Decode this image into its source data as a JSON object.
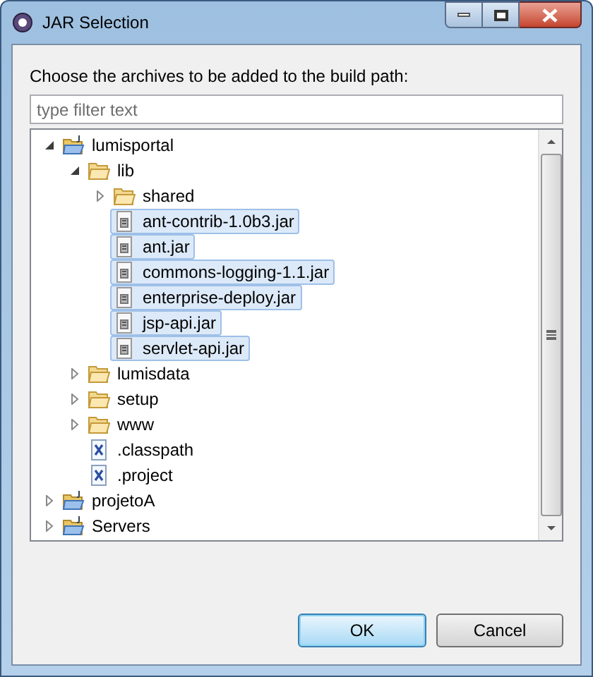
{
  "window": {
    "title": "JAR Selection"
  },
  "prompt": "Choose the archives to be added to the build path:",
  "filter": {
    "placeholder": "type filter text"
  },
  "tree": [
    {
      "label": "lumisportal",
      "kind": "project",
      "expanded": true,
      "selected": false,
      "children": [
        {
          "label": "lib",
          "kind": "folder",
          "expanded": true,
          "selected": false,
          "children": [
            {
              "label": "shared",
              "kind": "folder",
              "expanded": false,
              "selected": false
            },
            {
              "label": "ant-contrib-1.0b3.jar",
              "kind": "jar",
              "selected": true
            },
            {
              "label": "ant.jar",
              "kind": "jar",
              "selected": true
            },
            {
              "label": "commons-logging-1.1.jar",
              "kind": "jar",
              "selected": true
            },
            {
              "label": "enterprise-deploy.jar",
              "kind": "jar",
              "selected": true
            },
            {
              "label": "jsp-api.jar",
              "kind": "jar",
              "selected": true
            },
            {
              "label": "servlet-api.jar",
              "kind": "jar",
              "selected": true
            }
          ]
        },
        {
          "label": "lumisdata",
          "kind": "folder",
          "expanded": false,
          "selected": false
        },
        {
          "label": "setup",
          "kind": "folder",
          "expanded": false,
          "selected": false
        },
        {
          "label": "www",
          "kind": "folder",
          "expanded": false,
          "selected": false
        },
        {
          "label": ".classpath",
          "kind": "xml",
          "selected": false
        },
        {
          "label": ".project",
          "kind": "xml",
          "selected": false
        }
      ]
    },
    {
      "label": "projetoA",
      "kind": "project",
      "expanded": false,
      "selected": false
    },
    {
      "label": "Servers",
      "kind": "project",
      "expanded": false,
      "selected": false
    }
  ],
  "buttons": [
    {
      "label": "OK",
      "kind": "default"
    },
    {
      "label": "Cancel",
      "kind": "normal"
    }
  ]
}
